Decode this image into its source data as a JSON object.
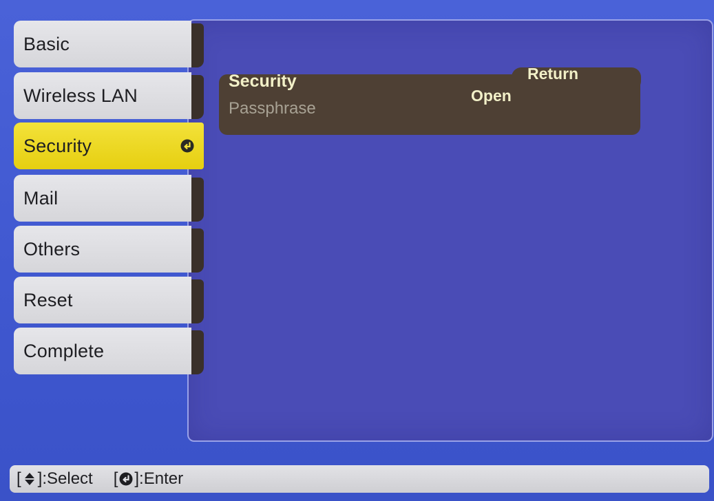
{
  "sidebar": {
    "items": [
      {
        "label": "Basic"
      },
      {
        "label": "Wireless LAN"
      },
      {
        "label": "Security"
      },
      {
        "label": "Mail"
      },
      {
        "label": "Others"
      },
      {
        "label": "Reset"
      },
      {
        "label": "Complete"
      }
    ]
  },
  "main": {
    "return_label": "Return",
    "security_label": "Security",
    "security_value": "Open",
    "passphrase_label": "Passphrase"
  },
  "footer": {
    "select_hint_open": "[",
    "select_hint_close": "]:Select",
    "enter_hint_open": "[",
    "enter_hint_close": "]:Enter"
  },
  "colors": {
    "background": "#4358d2",
    "panel": "#4a4cb6",
    "selected_tab": "#eed826",
    "settings_bar": "#4e4034",
    "active_text": "#f2f0c8",
    "disabled_text": "#a8a294"
  },
  "icons": {
    "enter": "enter-icon",
    "updown": "up-down-arrow-icon"
  }
}
